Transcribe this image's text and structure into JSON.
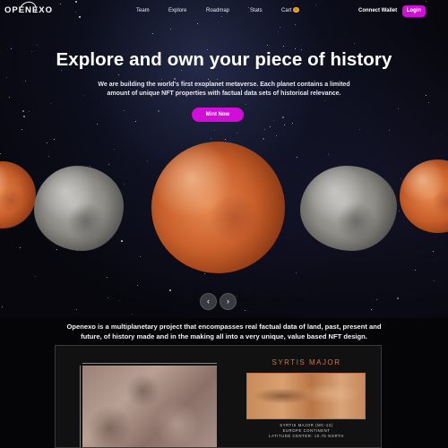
{
  "nav": {
    "logo": "OPENEXO",
    "links": [
      "Team",
      "Explore",
      "Roadmap",
      "Stats",
      "Cart"
    ],
    "cart_count": "0",
    "connect_wallet": "Connect Wallet",
    "login": "Login"
  },
  "hero": {
    "headline": "Explore and own your piece of history",
    "subtext": "We are building the world's first exoplanet metaverse. Each planet contains a limited amount of unique NFT properties with factual data sets of historical relevance.",
    "cta": "Mint Now"
  },
  "carousel": {
    "prev_icon": "chevron-left-icon",
    "next_icon": "chevron-right-icon",
    "prev_symbol": "‹",
    "next_symbol": "›"
  },
  "about": {
    "description": "Openexo is a multiplanetary project that encompasses real factual data of land, past, present and future, of history made and in the making all into a very unique, value based NFT design."
  },
  "card": {
    "title": "SYRTIS MAJOR",
    "caption_line1": "SYRTIS MAJOR (MC-13)",
    "caption_line2": "EUROPE CONTINENT",
    "caption_line3": "LATITUDE CENTER: 10.75 NORTH"
  },
  "colors": {
    "accent": "#d10ed8",
    "card_accent": "#c8793f"
  }
}
